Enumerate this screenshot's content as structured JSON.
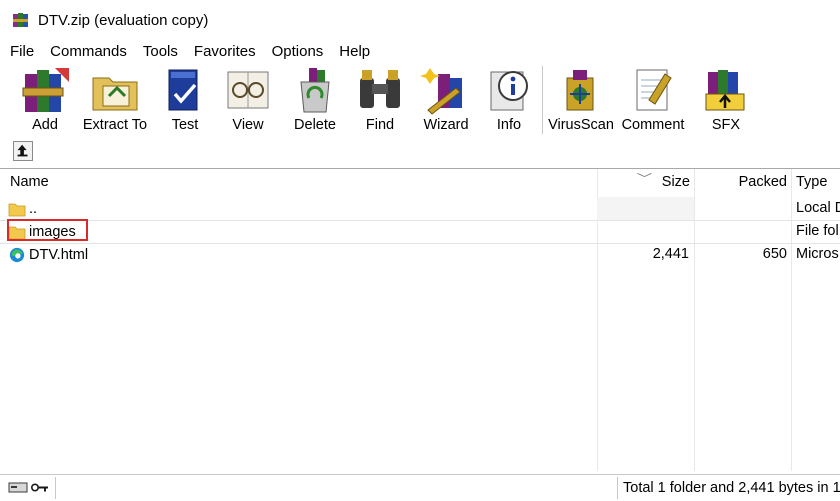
{
  "window": {
    "title": "DTV.zip (evaluation copy)",
    "app_icon": "winrar-books-icon"
  },
  "menu": [
    {
      "label": "File"
    },
    {
      "label": "Commands"
    },
    {
      "label": "Tools"
    },
    {
      "label": "Favorites"
    },
    {
      "label": "Options"
    },
    {
      "label": "Help"
    }
  ],
  "toolbar": {
    "buttons": [
      {
        "label": "Add",
        "icon": "books-box-icon"
      },
      {
        "label": "Extract To",
        "icon": "folder-extract-icon"
      },
      {
        "label": "Test",
        "icon": "checkmark-book-icon"
      },
      {
        "label": "View",
        "icon": "glasses-book-icon"
      },
      {
        "label": "Delete",
        "icon": "recycle-bin-icon"
      },
      {
        "label": "Find",
        "icon": "binoculars-icon"
      },
      {
        "label": "Wizard",
        "icon": "magic-wand-icon"
      },
      {
        "label": "Info",
        "icon": "info-book-icon"
      },
      {
        "label": "VirusScan",
        "icon": "virus-scan-icon"
      },
      {
        "label": "Comment",
        "icon": "comment-notepad-icon"
      },
      {
        "label": "SFX",
        "icon": "sfx-archive-icon"
      }
    ]
  },
  "up_button": {
    "icon": "up-arrow-icon"
  },
  "file_list": {
    "columns": [
      "Name",
      "Size",
      "Packed",
      "Type"
    ],
    "rows": [
      {
        "name": "..",
        "size": "",
        "packed": "",
        "type": "Local D",
        "icon": "folder-icon"
      },
      {
        "name": "images",
        "size": "",
        "packed": "",
        "type": "File fol",
        "icon": "folder-icon"
      },
      {
        "name": "DTV.html",
        "size": "2,441",
        "packed": "650",
        "type": "Micros",
        "icon": "edge-browser-icon"
      }
    ],
    "highlight_color": "#d92b2b"
  },
  "status": {
    "icons": [
      "drive-icon",
      "key-icon"
    ],
    "text": "Total 1 folder and 2,441 bytes in 1"
  }
}
